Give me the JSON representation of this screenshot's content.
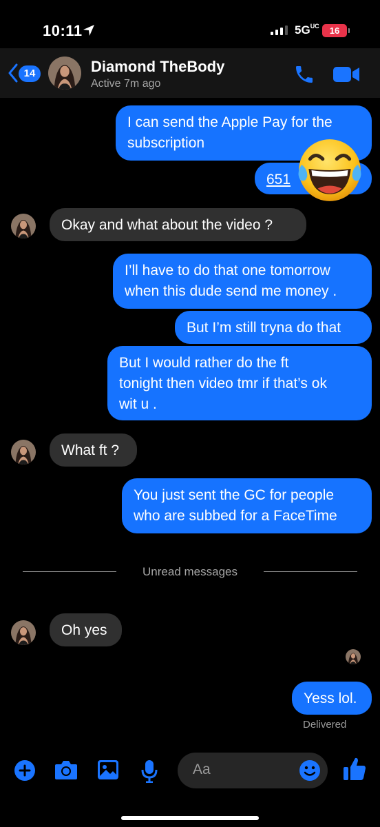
{
  "status_bar": {
    "time": "10:11",
    "network": "5G",
    "network_suffix": "UC",
    "battery": "16"
  },
  "header": {
    "back_count": "14",
    "contact_name": "Diamond TheBody",
    "active_status": "Active 7m ago"
  },
  "messages": [
    {
      "side": "out",
      "text_lines": [
        "I can send the Apple Pay for the",
        "subscription"
      ]
    },
    {
      "side": "out",
      "text": "651"
    },
    {
      "side": "in",
      "text": "Okay and what about the video ?"
    },
    {
      "side": "out",
      "text_lines": [
        "I’ll have to do that one tomorrow",
        "when this dude send me money ."
      ]
    },
    {
      "side": "out",
      "text": "But I’m still tryna do that"
    },
    {
      "side": "out",
      "text_lines": [
        "But I would rather do the ft",
        "tonight then video tmr if that’s ok",
        "wit u ."
      ]
    },
    {
      "side": "in",
      "text": "What ft ?"
    },
    {
      "side": "out",
      "text_lines": [
        "You just sent the GC for people",
        "who are subbed for a FaceTime"
      ]
    },
    {
      "side": "in",
      "text": "Oh yes"
    },
    {
      "side": "out",
      "text": "Yess lol."
    }
  ],
  "unread_divider": "Unread messages",
  "delivered_label": "Delivered",
  "composer": {
    "placeholder": "Aa"
  },
  "colors": {
    "outgoing_bubble": "#1673ff",
    "incoming_bubble": "#303030",
    "accent": "#1a74ff",
    "battery_low": "#e8334a"
  },
  "icons": [
    "location-arrow-icon",
    "signal-bars-icon",
    "back-chevron-icon",
    "phone-icon",
    "video-camera-icon",
    "plus-icon",
    "camera-icon",
    "image-icon",
    "microphone-icon",
    "smiley-icon",
    "thumbs-up-icon",
    "laughing-crying-emoji"
  ]
}
